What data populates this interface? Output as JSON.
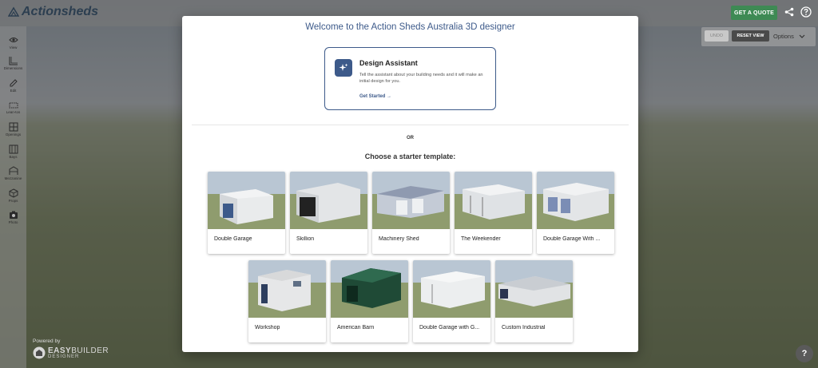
{
  "header": {
    "logo_text": "Actionsheds",
    "quote_label": "GET A QUOTE"
  },
  "sidebar": {
    "items": [
      {
        "label": "View",
        "icon": "eye-icon"
      },
      {
        "label": "Dimensions",
        "icon": "ruler-icon"
      },
      {
        "label": "Edit",
        "icon": "pencil-icon"
      },
      {
        "label": "Lean-tos",
        "icon": "lean-to-icon"
      },
      {
        "label": "Openings",
        "icon": "window-icon"
      },
      {
        "label": "Bays",
        "icon": "bays-icon"
      },
      {
        "label": "Mezzanine",
        "icon": "mezzanine-icon"
      },
      {
        "label": "Props",
        "icon": "box-icon"
      },
      {
        "label": "Photo",
        "icon": "camera-icon"
      }
    ]
  },
  "controls": {
    "undo_label": "UNDO",
    "reset_label": "RESET VIEW",
    "options_label": "Options"
  },
  "branding": {
    "powered_by": "Powered by",
    "easy": "EASY",
    "builder": "BUILDER",
    "designer": "DESIGNER"
  },
  "help_label": "?",
  "modal": {
    "title": "Welcome to the Action Sheds Australia 3D designer",
    "assistant": {
      "title": "Design Assistant",
      "description": "Tell the assistant about your building needs and it will make an initial design for you.",
      "cta": "Get Started →"
    },
    "or_label": "OR",
    "choose_label": "Choose a starter template:",
    "templates": [
      {
        "label": "Double Garage"
      },
      {
        "label": "Skillion"
      },
      {
        "label": "Machinery Shed"
      },
      {
        "label": "The Weekender"
      },
      {
        "label": "Double Garage With ..."
      },
      {
        "label": "Workshop"
      },
      {
        "label": "American Barn"
      },
      {
        "label": "Double Garage with G..."
      },
      {
        "label": "Custom Industrial"
      }
    ]
  },
  "colors": {
    "accent": "#3d5a8a",
    "quote_green": "#3e8a54"
  }
}
